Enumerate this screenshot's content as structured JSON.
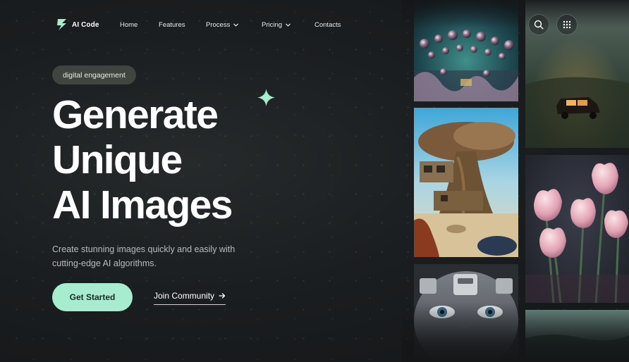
{
  "brand": {
    "name": "AI Code"
  },
  "nav": {
    "items": [
      {
        "label": "Home",
        "has_dropdown": false
      },
      {
        "label": "Features",
        "has_dropdown": false
      },
      {
        "label": "Process",
        "has_dropdown": true
      },
      {
        "label": "Pricing",
        "has_dropdown": true
      },
      {
        "label": "Contacts",
        "has_dropdown": false
      }
    ]
  },
  "header_actions": {
    "search_icon": "search-icon",
    "menu_icon": "grid-dots-icon"
  },
  "hero": {
    "badge": "digital engagement",
    "headline": [
      "Generate",
      "Unique",
      "AI Images"
    ],
    "subtext": "Create stunning images quickly and easily with cutting-edge AI algorithms.",
    "primary_cta": "Get Started",
    "secondary_cta": "Join Community",
    "secondary_cta_icon": "arrow-right-icon"
  },
  "colors": {
    "accent": "#a8ecd0",
    "background": "#1b1e20",
    "badge_bg": "#4a5046"
  },
  "gallery": {
    "images": [
      "bubbles-image",
      "car-image",
      "treehouse-image",
      "tulips-image",
      "robot-face-image",
      "meadow-image"
    ]
  }
}
